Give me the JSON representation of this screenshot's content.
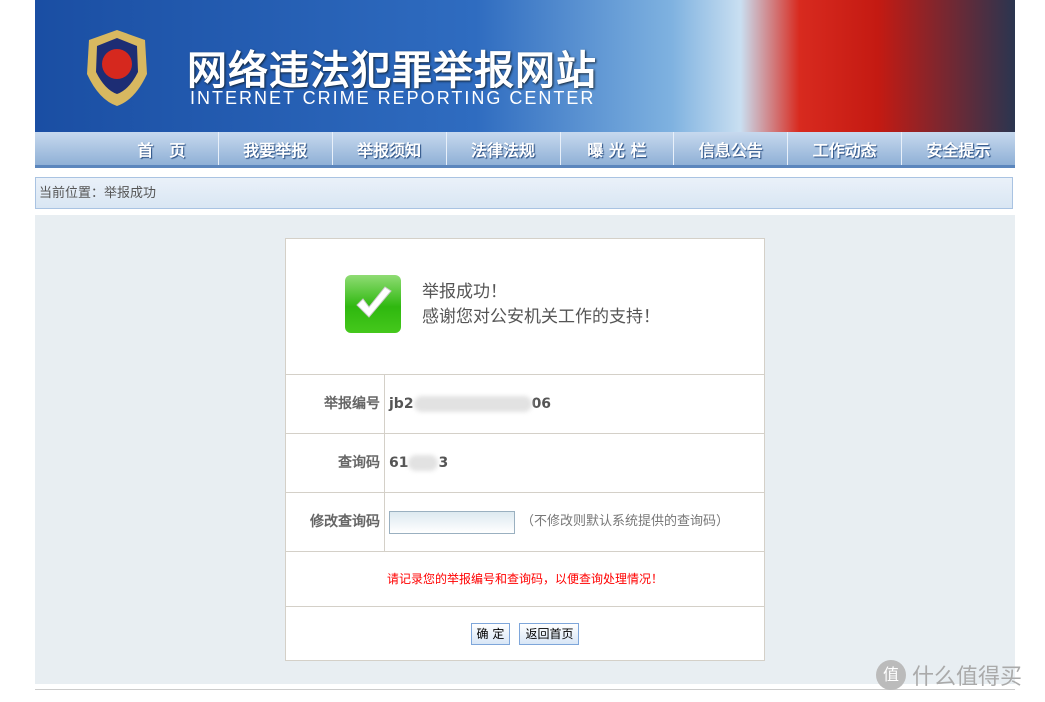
{
  "header": {
    "title_cn": "网络违法犯罪举报网站",
    "title_en": "INTERNET CRIME REPORTING CENTER"
  },
  "nav": {
    "items": [
      "首　页",
      "我要举报",
      "举报须知",
      "法律法规",
      "曝 光 栏",
      "信息公告",
      "工作动态",
      "安全提示"
    ]
  },
  "breadcrumb": "当前位置：举报成功",
  "success": {
    "title": "举报成功！",
    "message": "感谢您对公安机关工作的支持！",
    "icon": "check-icon",
    "color": "#2fb80f"
  },
  "form": {
    "report_no_label": "举报编号",
    "report_no_prefix": "jb2",
    "report_no_suffix": "06",
    "query_code_label": "查询码",
    "query_code_prefix": "61",
    "query_code_suffix": "3",
    "modify_label": "修改查询码",
    "modify_value": "",
    "modify_hint": "（不修改则默认系统提供的查询码）",
    "warning": "请记录您的举报编号和查询码，以便查询处理情况！",
    "warning_color": "#ff0000",
    "confirm": "确 定",
    "back_home": "返回首页"
  },
  "watermark": {
    "text": "什么值得买",
    "icon_text": "值"
  }
}
